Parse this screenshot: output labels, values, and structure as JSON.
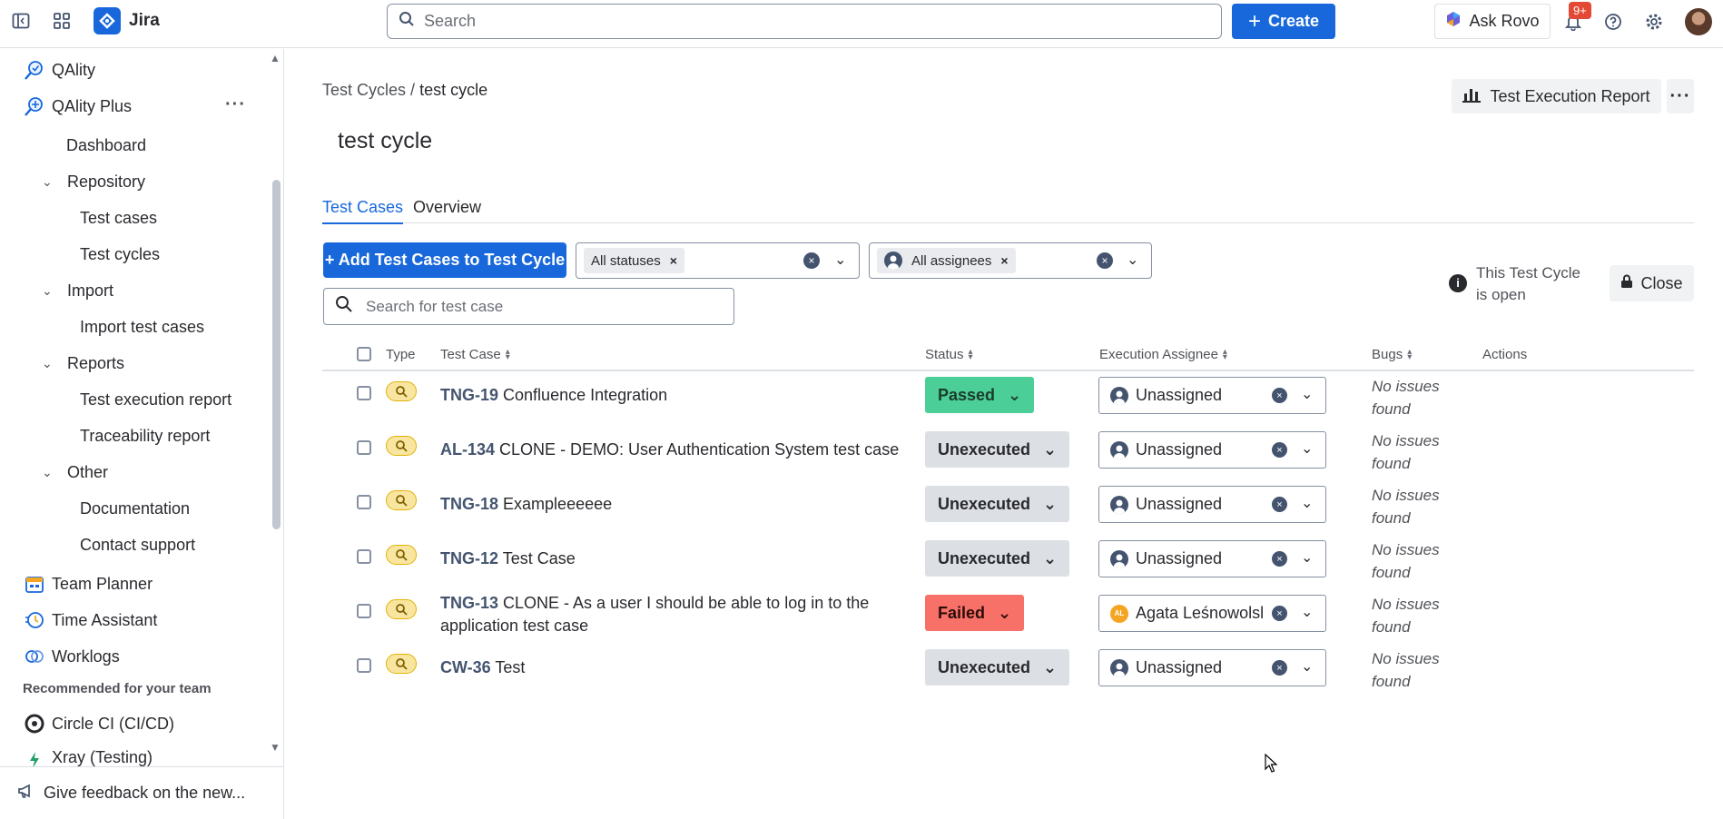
{
  "topbar": {
    "app_name": "Jira",
    "search_placeholder": "Search",
    "create_label": "Create",
    "rovo_label": "Ask Rovo",
    "notification_badge": "9+"
  },
  "sidebar": {
    "apps": [
      {
        "label": "QAlity",
        "icon": "qality-icon"
      },
      {
        "label": "QAlity Plus",
        "icon": "qality-plus-icon"
      }
    ],
    "qality_plus_items": {
      "dashboard": "Dashboard",
      "repository": "Repository",
      "test_cases": "Test cases",
      "test_cycles": "Test cycles",
      "import": "Import",
      "import_test_cases": "Import test cases",
      "reports": "Reports",
      "test_execution_report": "Test execution report",
      "traceability_report": "Traceability report",
      "other": "Other",
      "documentation": "Documentation",
      "contact_support": "Contact support"
    },
    "more_apps": [
      "Team Planner",
      "Time Assistant",
      "Worklogs"
    ],
    "recommended_heading": "Recommended for your team",
    "recommended": [
      "Circle CI (CI/CD)",
      "Xray (Testing)"
    ],
    "feedback": "Give feedback on the new..."
  },
  "main": {
    "breadcrumb_parent": "Test Cycles",
    "breadcrumb_sep": "/",
    "breadcrumb_current": "test cycle",
    "title": "test cycle",
    "report_button": "Test Execution Report",
    "tabs": [
      "Test Cases",
      "Overview"
    ],
    "add_button": "+ Add Test Cases to Test Cycle",
    "status_filter": "All statuses",
    "assignee_filter": "All assignees",
    "search_placeholder": "Search for test case",
    "cycle_status_text": "This Test Cycle is open",
    "close_button": "Close"
  },
  "table": {
    "headers": {
      "type": "Type",
      "test_case": "Test Case",
      "status": "Status",
      "assignee": "Execution Assignee",
      "bugs": "Bugs",
      "actions": "Actions"
    },
    "rows": [
      {
        "key": "TNG-19",
        "title": "Confluence Integration",
        "status": "Passed",
        "assignee": "Unassigned",
        "bugs": "No issues found"
      },
      {
        "key": "AL-134",
        "title": "CLONE - DEMO: User Authentication System test case",
        "status": "Unexecuted",
        "assignee": "Unassigned",
        "bugs": "No issues found"
      },
      {
        "key": "TNG-18",
        "title": "Exampleeeeee",
        "status": "Unexecuted",
        "assignee": "Unassigned",
        "bugs": "No issues found"
      },
      {
        "key": "TNG-12",
        "title": "Test Case",
        "status": "Unexecuted",
        "assignee": "Unassigned",
        "bugs": "No issues found"
      },
      {
        "key": "TNG-13",
        "title": "CLONE - As a user I should be able to log in to the application test case",
        "status": "Failed",
        "assignee": "Agata Leśnowolsl",
        "assignee_initials": "AL",
        "bugs": "No issues found"
      },
      {
        "key": "CW-36",
        "title": "Test",
        "status": "Unexecuted",
        "assignee": "Unassigned",
        "bugs": "No issues found"
      }
    ]
  },
  "colors": {
    "brand_blue": "#1868db",
    "passed": "#4bce97",
    "failed": "#f87168",
    "unexecuted": "#dcdfe4"
  }
}
